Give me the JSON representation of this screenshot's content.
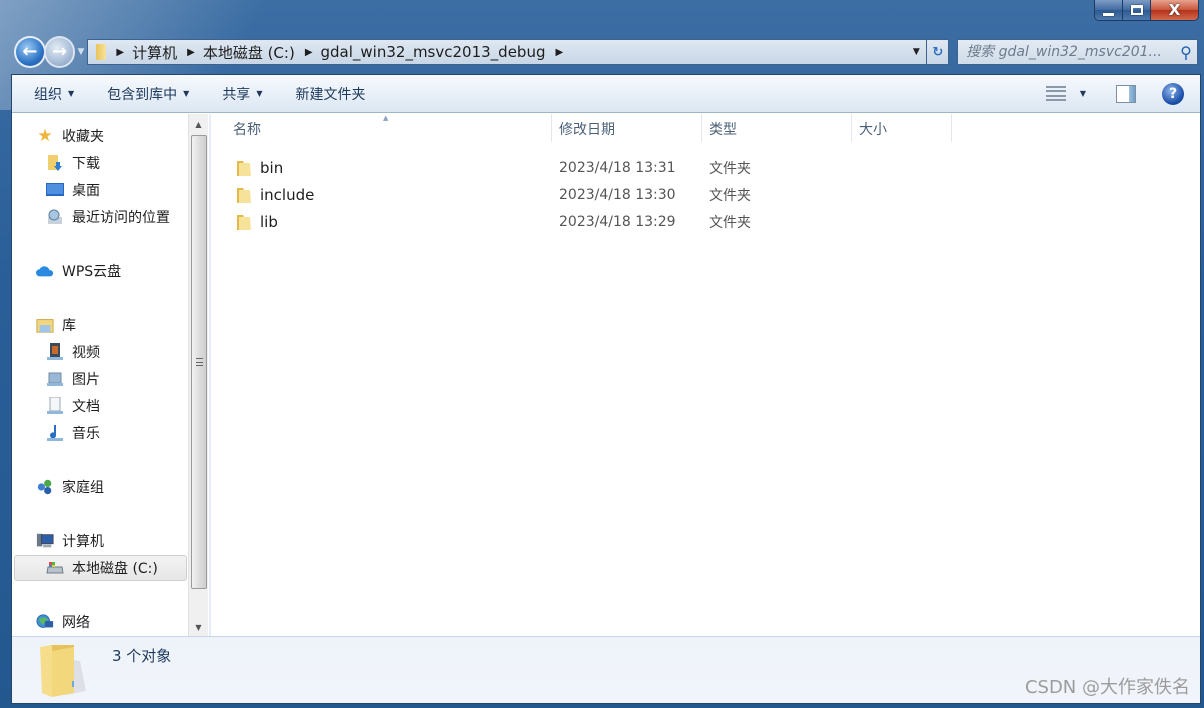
{
  "window": {
    "minimize_label": "minimize",
    "maximize_label": "maximize",
    "close_glyph": "X"
  },
  "address": {
    "back_glyph": "←",
    "forward_glyph": "→",
    "breadcrumbs": [
      "计算机",
      "本地磁盘 (C:)",
      "gdal_win32_msvc2013_debug"
    ],
    "search_placeholder": "搜索 gdal_win32_msvc201...",
    "search_icon": "search-icon",
    "refresh_glyph": "↻"
  },
  "toolbar": {
    "organize": "组织",
    "include_in_library": "包含到库中",
    "share": "共享",
    "new_folder": "新建文件夹",
    "help_glyph": "?"
  },
  "nav": {
    "favorites": {
      "label": "收藏夹",
      "items": [
        "下载",
        "桌面",
        "最近访问的位置"
      ]
    },
    "wps_cloud": "WPS云盘",
    "libraries": {
      "label": "库",
      "items": [
        "视频",
        "图片",
        "文档",
        "音乐"
      ]
    },
    "homegroup": "家庭组",
    "computer": {
      "label": "计算机",
      "items": [
        "本地磁盘 (C:)"
      ],
      "selected": "本地磁盘 (C:)"
    },
    "network": "网络"
  },
  "file_list": {
    "columns": [
      "名称",
      "修改日期",
      "类型",
      "大小"
    ],
    "sorted_by": "名称",
    "rows": [
      {
        "name": "bin",
        "modified": "2023/4/18 13:31",
        "type": "文件夹",
        "size": ""
      },
      {
        "name": "include",
        "modified": "2023/4/18 13:30",
        "type": "文件夹",
        "size": ""
      },
      {
        "name": "lib",
        "modified": "2023/4/18 13:29",
        "type": "文件夹",
        "size": ""
      }
    ]
  },
  "details": {
    "count": "3 个对象"
  },
  "watermark": "CSDN @大作家佚名",
  "colors": {
    "frame": "#235a94",
    "toolbar_text": "#1e395b",
    "header_text": "#4c607a",
    "folder": "#f0cf6c"
  }
}
